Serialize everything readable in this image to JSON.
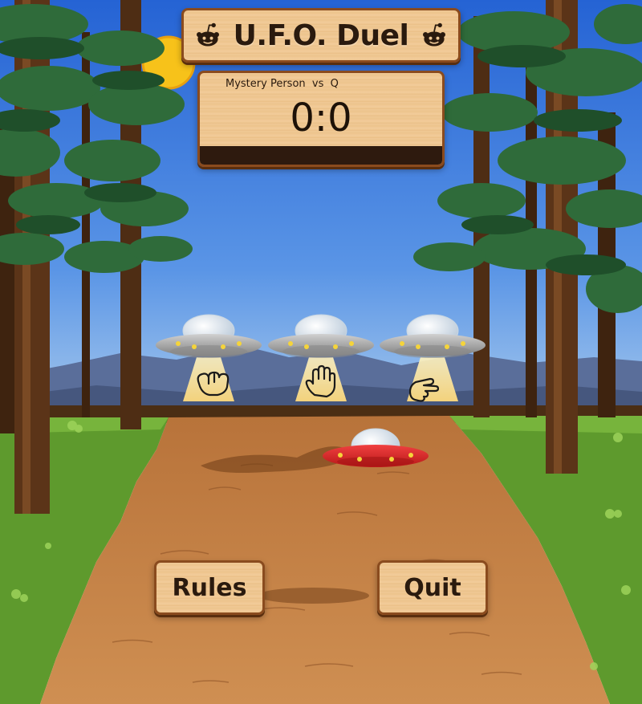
{
  "game": {
    "title": "U.F.O. Duel",
    "player_one": "Mystery Person",
    "versus": "vs",
    "player_two": "Q",
    "score": "0:0"
  },
  "choices": [
    {
      "name": "rock",
      "icon": "fist-icon"
    },
    {
      "name": "paper",
      "icon": "open-hand-icon"
    },
    {
      "name": "scissors",
      "icon": "scissors-hand-icon"
    }
  ],
  "buttons": {
    "rules_label": "Rules",
    "quit_label": "Quit"
  },
  "colors": {
    "sky_top": "#2a6ad6",
    "sky_bottom": "#a6c8e8",
    "grass": "#5f9a2e",
    "path": "#c9874a",
    "wood": "#f0c995",
    "wood_border": "#8a4b1e",
    "ufo_gray": "#a8a8a8",
    "ufo_red": "#e02a2a",
    "beam": "#f6dc8c"
  }
}
